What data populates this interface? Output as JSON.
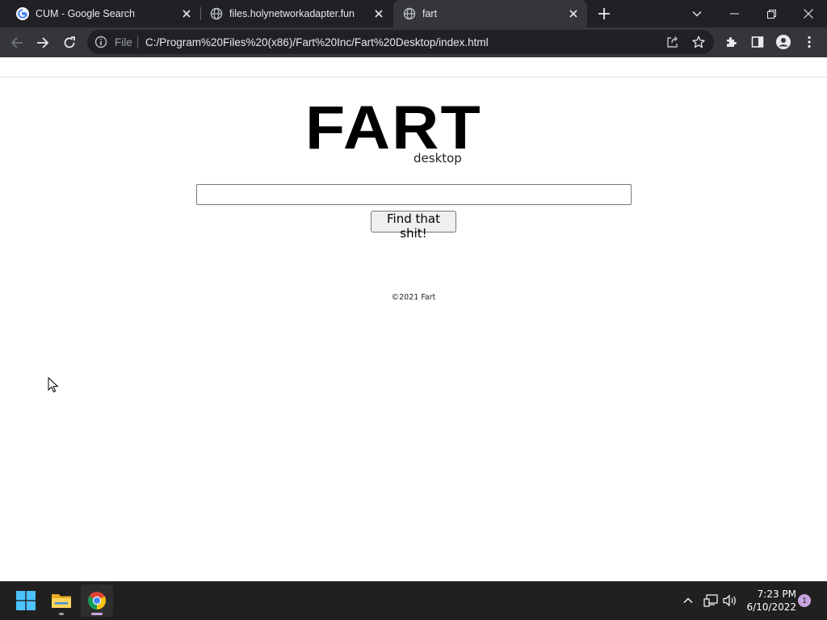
{
  "browser": {
    "tabs": [
      {
        "title": "CUM - Google Search",
        "icon": "google-icon",
        "active": false
      },
      {
        "title": "files.holynetworkadapter.fun",
        "icon": "globe-icon",
        "active": false
      },
      {
        "title": "fart",
        "icon": "globe-icon",
        "active": true
      }
    ],
    "address_bar": {
      "scheme_label": "File",
      "url": "C:/Program%20Files%20(x86)/Fart%20Inc/Fart%20Desktop/index.html"
    }
  },
  "page": {
    "logo": {
      "main": "FART",
      "sub": "desktop"
    },
    "search": {
      "value": "",
      "placeholder": ""
    },
    "search_button_label": "Find that shit!",
    "footer": "©2021 Fart"
  },
  "taskbar": {
    "clock": {
      "time": "7:23 PM",
      "date": "6/10/2022"
    },
    "notification_count": "1"
  },
  "colors": {
    "tab_strip": "#202124",
    "toolbar": "#35363a",
    "taskbar": "#202020",
    "accent_notification": "#c7a6e0"
  }
}
